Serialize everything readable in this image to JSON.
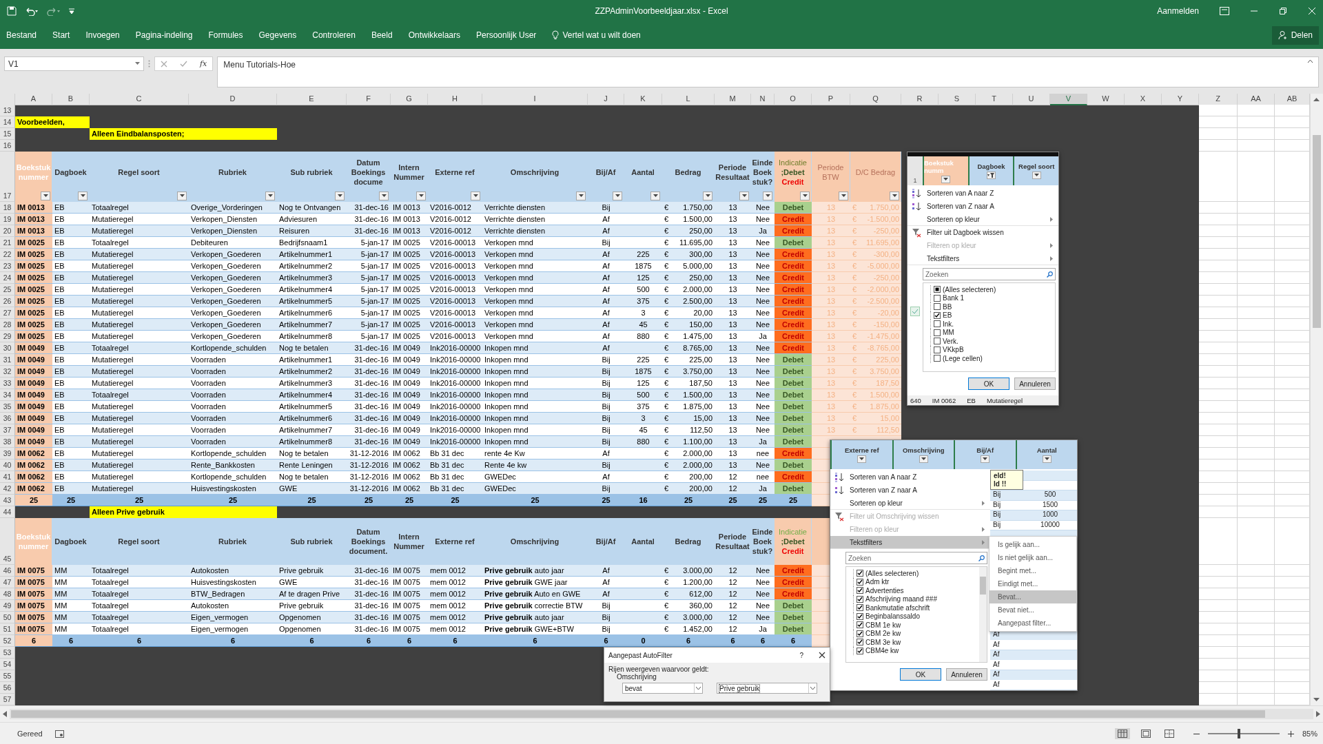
{
  "title_bar": {
    "title": "ZZPAdminVoorbeeldjaar.xlsx - Excel",
    "sign_in": "Aanmelden"
  },
  "ribbon": {
    "tabs": [
      "Bestand",
      "Start",
      "Invoegen",
      "Pagina-indeling",
      "Formules",
      "Gegevens",
      "Controleren",
      "Beeld",
      "Ontwikkelaars",
      "Persoonlijk User"
    ],
    "tell_me": "Vertel wat u wilt doen",
    "share": "Delen"
  },
  "formula_bar": {
    "name_box": "V1",
    "function_label": "fx",
    "formula": "Menu Tutorials-Hoe"
  },
  "columns": [
    {
      "label": "A",
      "selected": false
    },
    {
      "label": "B",
      "selected": false
    },
    {
      "label": "C",
      "selected": false
    },
    {
      "label": "D",
      "selected": false
    },
    {
      "label": "E",
      "selected": false
    },
    {
      "label": "F",
      "selected": false
    },
    {
      "label": "G",
      "selected": false
    },
    {
      "label": "H",
      "selected": false
    },
    {
      "label": "I",
      "selected": false
    },
    {
      "label": "J",
      "selected": false
    },
    {
      "label": "K",
      "selected": false
    },
    {
      "label": "L",
      "selected": false
    },
    {
      "label": "M",
      "selected": false
    },
    {
      "label": "N",
      "selected": false
    },
    {
      "label": "O",
      "selected": false
    },
    {
      "label": "P",
      "selected": false
    },
    {
      "label": "Q",
      "selected": false
    },
    {
      "label": "R",
      "selected": false
    },
    {
      "label": "S",
      "selected": false
    },
    {
      "label": "T",
      "selected": false
    },
    {
      "label": "U",
      "selected": false
    },
    {
      "label": "V",
      "selected": true
    },
    {
      "label": "W",
      "selected": false
    },
    {
      "label": "X",
      "selected": false
    },
    {
      "label": "Y",
      "selected": false
    },
    {
      "label": "Z",
      "selected": false
    },
    {
      "label": "AA",
      "selected": false
    },
    {
      "label": "AB",
      "selected": false
    }
  ],
  "rows": [
    {
      "n": "13",
      "kind": "blank"
    },
    {
      "n": "14",
      "kind": "label",
      "column_a": "Voorbeelden,"
    },
    {
      "n": "15",
      "kind": "label",
      "column_c": "Alleen Eindbalansposten;"
    },
    {
      "n": "16",
      "kind": "blank"
    },
    {
      "n": "17",
      "kind": "header",
      "filters": true,
      "cells": [
        "Boekstuk nummer",
        "Dagboek",
        "Regel soort",
        "Rubriek",
        "Sub rubriek",
        "Datum Boekings docume",
        "Intern Nummer",
        "Externe ref",
        "Omschrijving",
        "Bij/Af",
        "Aantal",
        "Bedrag",
        "Periode Resultaat",
        "Einde Boek stuk?",
        [
          "Indicatie",
          ";Debet",
          "Credit"
        ],
        "Periode BTW",
        "D/C Bedrag"
      ]
    },
    {
      "n": "18",
      "kind": "data",
      "credit": false,
      "cells": [
        "IM 0013",
        "EB",
        "Totaalregel",
        "Overige_Vorderingen",
        "Nog te Ontvangen",
        "31-dec-16",
        "IM 0013",
        "V2016-0012",
        "Verrichte diensten",
        "Bij",
        null,
        "€",
        "1.750,00",
        "13",
        "Nee",
        "Debet",
        "13",
        "€",
        "1.750,00"
      ]
    },
    {
      "n": "19",
      "kind": "data",
      "credit": true,
      "cells": [
        "IM 0013",
        "EB",
        "Mutatieregel",
        "Verkopen_Diensten",
        "Adviesuren",
        "31-dec-16",
        "IM 0013",
        "V2016-0012",
        "Verrichte diensten",
        "Af",
        null,
        "€",
        "1.500,00",
        "13",
        "Nee",
        "Credit",
        "13",
        "€",
        "-1.500,00"
      ]
    },
    {
      "n": "20",
      "kind": "data",
      "credit": true,
      "cells": [
        "IM 0013",
        "EB",
        "Mutatieregel",
        "Verkopen_Diensten",
        "Reisuren",
        "31-dec-16",
        "IM 0013",
        "V2016-0012",
        "Verrichte diensten",
        "Af",
        null,
        "€",
        "250,00",
        "13",
        "Ja",
        "Credit",
        "13",
        "€",
        "-250,00"
      ]
    },
    {
      "n": "21",
      "kind": "data",
      "credit": false,
      "cells": [
        "IM 0025",
        "EB",
        "Totaalregel",
        "Debiteuren",
        "Bedrijfsnaam1",
        "5-jan-17",
        "IM 0025",
        "V2016-00013",
        "Verkopen mnd",
        "Bij",
        null,
        "€",
        "11.695,00",
        "13",
        "Nee",
        "Debet",
        "13",
        "€",
        "11.695,00"
      ]
    },
    {
      "n": "22",
      "kind": "data",
      "credit": true,
      "cells": [
        "IM 0025",
        "EB",
        "Mutatieregel",
        "Verkopen_Goederen",
        "Artikelnummer1",
        "5-jan-17",
        "IM 0025",
        "V2016-00013",
        "Verkopen mnd",
        "Af",
        "225",
        "€",
        "300,00",
        "13",
        "Nee",
        "Credit",
        "13",
        "€",
        "-300,00"
      ]
    },
    {
      "n": "23",
      "kind": "data",
      "credit": true,
      "cells": [
        "IM 0025",
        "EB",
        "Mutatieregel",
        "Verkopen_Goederen",
        "Artikelnummer2",
        "5-jan-17",
        "IM 0025",
        "V2016-00013",
        "Verkopen mnd",
        "Af",
        "1875",
        "€",
        "5.000,00",
        "13",
        "Nee",
        "Credit",
        "13",
        "€",
        "-5.000,00"
      ]
    },
    {
      "n": "24",
      "kind": "data",
      "credit": true,
      "cells": [
        "IM 0025",
        "EB",
        "Mutatieregel",
        "Verkopen_Goederen",
        "Artikelnummer3",
        "5-jan-17",
        "IM 0025",
        "V2016-00013",
        "Verkopen mnd",
        "Af",
        "125",
        "€",
        "250,00",
        "13",
        "Nee",
        "Credit",
        "13",
        "€",
        "-250,00"
      ]
    },
    {
      "n": "25",
      "kind": "data",
      "credit": true,
      "cells": [
        "IM 0025",
        "EB",
        "Mutatieregel",
        "Verkopen_Goederen",
        "Artikelnummer4",
        "5-jan-17",
        "IM 0025",
        "V2016-00013",
        "Verkopen mnd",
        "Af",
        "500",
        "€",
        "2.000,00",
        "13",
        "Nee",
        "Credit",
        "13",
        "€",
        "-2.000,00"
      ]
    },
    {
      "n": "26",
      "kind": "data",
      "credit": true,
      "cells": [
        "IM 0025",
        "EB",
        "Mutatieregel",
        "Verkopen_Goederen",
        "Artikelnummer5",
        "5-jan-17",
        "IM 0025",
        "V2016-00013",
        "Verkopen mnd",
        "Af",
        "375",
        "€",
        "2.500,00",
        "13",
        "Nee",
        "Credit",
        "13",
        "€",
        "-2.500,00"
      ]
    },
    {
      "n": "27",
      "kind": "data",
      "credit": true,
      "cells": [
        "IM 0025",
        "EB",
        "Mutatieregel",
        "Verkopen_Goederen",
        "Artikelnummer6",
        "5-jan-17",
        "IM 0025",
        "V2016-00013",
        "Verkopen mnd",
        "Af",
        "3",
        "€",
        "20,00",
        "13",
        "Nee",
        "Credit",
        "13",
        "€",
        "-20,00"
      ]
    },
    {
      "n": "28",
      "kind": "data",
      "credit": true,
      "cells": [
        "IM 0025",
        "EB",
        "Mutatieregel",
        "Verkopen_Goederen",
        "Artikelnummer7",
        "5-jan-17",
        "IM 0025",
        "V2016-00013",
        "Verkopen mnd",
        "Af",
        "45",
        "€",
        "150,00",
        "13",
        "Nee",
        "Credit",
        "13",
        "€",
        "-150,00"
      ]
    },
    {
      "n": "29",
      "kind": "data",
      "credit": true,
      "cells": [
        "IM 0025",
        "EB",
        "Mutatieregel",
        "Verkopen_Goederen",
        "Artikelnummer8",
        "5-jan-17",
        "IM 0025",
        "V2016-00013",
        "Verkopen mnd",
        "Af",
        "880",
        "€",
        "1.475,00",
        "13",
        "Ja",
        "Credit",
        "13",
        "€",
        "-1.475,00"
      ]
    },
    {
      "n": "30",
      "kind": "data",
      "credit": true,
      "cells": [
        "IM 0049",
        "EB",
        "Totaalregel",
        "Kortlopende_schulden",
        "Nog te betalen",
        "31-dec-16",
        "IM 0049",
        "Ink2016-00000",
        "Inkopen mnd",
        "Af",
        null,
        "€",
        "8.765,00",
        "13",
        "Nee",
        "Credit",
        "13",
        "€",
        "-8.765,00"
      ]
    },
    {
      "n": "31",
      "kind": "data",
      "credit": false,
      "cells": [
        "IM 0049",
        "EB",
        "Mutatieregel",
        "Voorraden",
        "Artikelnummer1",
        "31-dec-16",
        "IM 0049",
        "Ink2016-00000",
        "Inkopen mnd",
        "Bij",
        "225",
        "€",
        "225,00",
        "13",
        "Nee",
        "Debet",
        "13",
        "€",
        "225,00"
      ]
    },
    {
      "n": "32",
      "kind": "data",
      "credit": false,
      "cells": [
        "IM 0049",
        "EB",
        "Mutatieregel",
        "Voorraden",
        "Artikelnummer2",
        "31-dec-16",
        "IM 0049",
        "Ink2016-00000",
        "Inkopen mnd",
        "Bij",
        "1875",
        "€",
        "3.750,00",
        "13",
        "Nee",
        "Debet",
        "13",
        "€",
        "3.750,00"
      ]
    },
    {
      "n": "33",
      "kind": "data",
      "credit": false,
      "cells": [
        "IM 0049",
        "EB",
        "Mutatieregel",
        "Voorraden",
        "Artikelnummer3",
        "31-dec-16",
        "IM 0049",
        "Ink2016-00000",
        "Inkopen mnd",
        "Bij",
        "125",
        "€",
        "187,50",
        "13",
        "Nee",
        "Debet",
        "13",
        "€",
        "187,50"
      ]
    },
    {
      "n": "34",
      "kind": "data",
      "credit": false,
      "cells": [
        "IM 0049",
        "EB",
        "Totaalregel",
        "Voorraden",
        "Artikelnummer4",
        "31-dec-16",
        "IM 0049",
        "Ink2016-00000",
        "Inkopen mnd",
        "Bij",
        "500",
        "€",
        "1.500,00",
        "13",
        "Nee",
        "Debet",
        "13",
        "€",
        "1.500,00"
      ]
    },
    {
      "n": "35",
      "kind": "data",
      "credit": false,
      "cells": [
        "IM 0049",
        "EB",
        "Mutatieregel",
        "Voorraden",
        "Artikelnummer5",
        "31-dec-16",
        "IM 0049",
        "Ink2016-00000",
        "Inkopen mnd",
        "Bij",
        "375",
        "€",
        "1.875,00",
        "13",
        "Nee",
        "Debet",
        "13",
        "€",
        "1.875,00"
      ]
    },
    {
      "n": "36",
      "kind": "data",
      "credit": false,
      "cells": [
        "IM 0049",
        "EB",
        "Mutatieregel",
        "Voorraden",
        "Artikelnummer6",
        "31-dec-16",
        "IM 0049",
        "Ink2016-00000",
        "Inkopen mnd",
        "Bij",
        "3",
        "€",
        "15,00",
        "13",
        "Nee",
        "Debet",
        "13",
        "€",
        "15,00"
      ]
    },
    {
      "n": "37",
      "kind": "data",
      "credit": false,
      "cells": [
        "IM 0049",
        "EB",
        "Mutatieregel",
        "Voorraden",
        "Artikelnummer7",
        "31-dec-16",
        "IM 0049",
        "Ink2016-00000",
        "Inkopen mnd",
        "Bij",
        "45",
        "€",
        "112,50",
        "13",
        "Nee",
        "Debet",
        "13",
        "€",
        "112,50"
      ]
    },
    {
      "n": "38",
      "kind": "data",
      "credit": false,
      "cells": [
        "IM 0049",
        "EB",
        "Mutatieregel",
        "Voorraden",
        "Artikelnummer8",
        "31-dec-16",
        "IM 0049",
        "Ink2016-00000",
        "Inkopen mnd",
        "Bij",
        "880",
        "€",
        "1.100,00",
        "13",
        "Ja",
        "Debet",
        null,
        null,
        null
      ]
    },
    {
      "n": "39",
      "kind": "data",
      "credit": true,
      "cells": [
        "IM 0062",
        "EB",
        "Mutatieregel",
        "Kortlopende_schulden",
        "Nog te betalen",
        "31-12-2016",
        "IM 0062",
        "Bb 31 dec",
        "rente 4e Kw",
        "Af",
        null,
        "€",
        "2.000,00",
        "13",
        "nee",
        "Credit",
        null,
        null,
        null
      ]
    },
    {
      "n": "40",
      "kind": "data",
      "credit": false,
      "cells": [
        "IM 0062",
        "EB",
        "Mutatieregel",
        "Rente_Bankkosten",
        "Rente Leningen",
        "31-12-2016",
        "IM 0062",
        "Bb 31 dec",
        "Rente 4e kw",
        "Bij",
        null,
        "€",
        "2.000,00",
        "13",
        "Nee",
        "Debet",
        null,
        null,
        null
      ]
    },
    {
      "n": "41",
      "kind": "data",
      "credit": true,
      "cells": [
        "IM 0062",
        "EB",
        "Mutatieregel",
        "Kortlopende_schulden",
        "Nog te betalen",
        "31-12-2016",
        "IM 0062",
        "Bb 31 dec",
        "GWEDec",
        "Af",
        null,
        "€",
        "200,00",
        "12",
        "nee",
        "Credit",
        null,
        null,
        null
      ]
    },
    {
      "n": "42",
      "kind": "data",
      "credit": false,
      "cells": [
        "IM 0062",
        "EB",
        "Mutatieregel",
        "Huisvestingskosten",
        "GWE",
        "31-12-2016",
        "IM 0062",
        "Bb 31 dec",
        "GWEDec",
        "Bij",
        null,
        "€",
        "200,00",
        "12",
        "Ja",
        "Debet",
        null,
        null,
        null
      ]
    },
    {
      "n": "43",
      "kind": "total",
      "cells": [
        "25",
        "25",
        "25",
        "25",
        "25",
        "25",
        "25",
        "25",
        "25",
        "25",
        "16",
        "25",
        "25",
        "25",
        "25"
      ]
    },
    {
      "n": "44",
      "kind": "label",
      "column_c": "Alleen Prive gebruik"
    },
    {
      "n": "45",
      "kind": "header",
      "filters": false,
      "cells": [
        "Boekstuk nummer",
        "Dagboek",
        "Regel soort",
        "Rubriek",
        "Sub rubriek",
        "Datum Boekings document.",
        "Intern Nummer",
        "Externe ref",
        "Omschrijving",
        "Bij/Af",
        "Aantal",
        "Bedrag",
        "Periode Resultaat",
        "Einde Boek stuk?",
        [
          "Indicatie",
          ";Debet",
          "Credit"
        ],
        null,
        null
      ]
    },
    {
      "n": "46",
      "kind": "data",
      "credit": true,
      "cells": [
        "IM 0075",
        "MM",
        "Totaalregel",
        "Autokosten",
        "Prive gebruik",
        "31-dec-16",
        "IM 0075",
        "mem 0012",
        "**Prive gebruik** auto jaar",
        "Af",
        null,
        "€",
        "3.000,00",
        "12",
        "Nee",
        "Credit",
        null,
        null,
        null
      ]
    },
    {
      "n": "47",
      "kind": "data",
      "credit": true,
      "cells": [
        "IM 0075",
        "MM",
        "Totaalregel",
        "Huisvestingskosten",
        "GWE",
        "31-dec-16",
        "IM 0075",
        "mem 0012",
        "**Prive gebruik** GWE jaar",
        "Af",
        null,
        "€",
        "1.200,00",
        "12",
        "Nee",
        "Credit",
        null,
        null,
        null
      ]
    },
    {
      "n": "48",
      "kind": "data",
      "credit": true,
      "cells": [
        "IM 0075",
        "MM",
        "Totaalregel",
        "BTW_Bedragen",
        "Af te dragen Prive",
        "31-dec-16",
        "IM 0075",
        "mem 0012",
        "**Prive gebruik** Auto en GWE",
        "Af",
        null,
        "€",
        "612,00",
        "12",
        "Nee",
        "Credit",
        null,
        null,
        null
      ]
    },
    {
      "n": "49",
      "kind": "data",
      "credit": false,
      "cells": [
        "IM 0075",
        "MM",
        "Totaalregel",
        "Autokosten",
        "Prive gebruik",
        "31-dec-16",
        "IM 0075",
        "mem 0012",
        "**Prive gebruik** correctie BTW",
        "Bij",
        null,
        "€",
        "360,00",
        "12",
        "Nee",
        "Debet",
        null,
        null,
        null
      ]
    },
    {
      "n": "50",
      "kind": "data",
      "credit": false,
      "cells": [
        "IM 0075",
        "MM",
        "Totaalregel",
        "Eigen_vermogen",
        "Opgenomen",
        "31-dec-16",
        "IM 0075",
        "mem 0012",
        "**Prive gebruik** auto jaar",
        "Bij",
        null,
        "€",
        "3.000,00",
        "12",
        "Nee",
        "Debet",
        null,
        null,
        null
      ]
    },
    {
      "n": "51",
      "kind": "data",
      "credit": false,
      "cells": [
        "IM 0075",
        "MM",
        "Totaalregel",
        "Eigen_vermogen",
        "Opgenomen",
        "31-dec-16",
        "IM 0075",
        "mem 0012",
        "**Prive gebruik** GWE+BTW",
        "Bij",
        null,
        "€",
        "1.452,00",
        "12",
        "Ja",
        "Debet",
        null,
        null,
        null
      ]
    },
    {
      "n": "52",
      "kind": "total",
      "cells": [
        "6",
        "6",
        "6",
        "6",
        "6",
        "6",
        "6",
        "6",
        "6",
        "6",
        "0",
        "6",
        "6",
        "6",
        "6"
      ]
    },
    {
      "n": "53",
      "kind": "blank"
    },
    {
      "n": "54",
      "kind": "blank"
    },
    {
      "n": "55",
      "kind": "blank"
    },
    {
      "n": "56",
      "kind": "blank"
    },
    {
      "n": "57",
      "kind": "blank"
    }
  ],
  "filter_popups": [
    {
      "row_number": "1",
      "headers": [
        {
          "label": "Boekstuk numm",
          "filtered": false
        },
        {
          "label": "Dagboek",
          "filtered": true
        },
        {
          "label": "Regel soort",
          "filtered": false
        }
      ],
      "menu": [
        {
          "label": "Sorteren van A naar Z",
          "kind": "sort-az",
          "disabled": false,
          "submenu": false,
          "selected": false
        },
        {
          "label": "Sorteren van Z naar A",
          "kind": "sort-za",
          "disabled": false,
          "submenu": false,
          "selected": false
        },
        {
          "label": "Sorteren op kleur",
          "kind": "plain",
          "disabled": false,
          "submenu": true,
          "selected": false
        },
        {
          "label": "Filter uit Dagboek wissen",
          "kind": "clear",
          "disabled": false,
          "submenu": false,
          "selected": false
        },
        {
          "label": "Filteren op kleur",
          "kind": "plain",
          "disabled": true,
          "submenu": true,
          "selected": false
        },
        {
          "label": "Tekstfilters",
          "kind": "plain",
          "disabled": false,
          "submenu": true,
          "selected": false
        }
      ],
      "search": {
        "placeholder": "Zoeken"
      },
      "options": [
        {
          "label": "(Alles selecteren)",
          "checked": false,
          "partial": true
        },
        {
          "label": "Bank 1",
          "checked": false,
          "partial": false
        },
        {
          "label": "BB",
          "checked": false,
          "partial": false
        },
        {
          "label": "EB",
          "checked": true,
          "partial": false
        },
        {
          "label": "Ink.",
          "checked": false,
          "partial": false
        },
        {
          "label": "MM",
          "checked": false,
          "partial": false
        },
        {
          "label": "Verk.",
          "checked": false,
          "partial": false
        },
        {
          "label": "VKkpB",
          "checked": false,
          "partial": false
        },
        {
          "label": "(Lege cellen)",
          "checked": false,
          "partial": false
        }
      ],
      "buttons": [
        "OK",
        "Annuleren"
      ],
      "footer_row": [
        "640",
        "IM 0062",
        "EB",
        "Mutatieregel"
      ]
    },
    {
      "headers": [
        {
          "label": "Externe ref",
          "filtered": false
        },
        {
          "label": "Omschrijving",
          "filtered": false
        },
        {
          "label": "Bij/Af",
          "filtered": false
        },
        {
          "label": "Aantal",
          "filtered": false
        }
      ],
      "menu": [
        {
          "label": "Sorteren van A naar Z",
          "kind": "sort-az",
          "disabled": false,
          "submenu": false,
          "selected": false
        },
        {
          "label": "Sorteren van Z naar A",
          "kind": "sort-za",
          "disabled": false,
          "submenu": false,
          "selected": false
        },
        {
          "label": "Sorteren op kleur",
          "kind": "plain",
          "disabled": false,
          "submenu": true,
          "selected": false
        },
        {
          "label": "Filter uit Omschrijving wissen",
          "kind": "clear",
          "disabled": true,
          "submenu": false,
          "selected": false
        },
        {
          "label": "Filteren op kleur",
          "kind": "plain",
          "disabled": true,
          "submenu": true,
          "selected": false
        },
        {
          "label": "Tekstfilters",
          "kind": "plain",
          "disabled": false,
          "submenu": true,
          "selected": true
        }
      ],
      "search": {
        "placeholder": "Zoeken"
      },
      "options": [
        {
          "label": "(Alles selecteren)",
          "checked": true,
          "partial": false
        },
        {
          "label": "Adm ktr",
          "checked": true,
          "partial": false
        },
        {
          "label": "Advertenties",
          "checked": true,
          "partial": false
        },
        {
          "label": "Afschrijving maand ###",
          "checked": true,
          "partial": false
        },
        {
          "label": "Bankmutatie afschrift",
          "checked": true,
          "partial": false
        },
        {
          "label": "Beginbalanssaldo",
          "checked": true,
          "partial": false
        },
        {
          "label": "CBM 1e kw",
          "checked": true,
          "partial": false
        },
        {
          "label": "CBM 2e kw",
          "checked": true,
          "partial": false
        },
        {
          "label": "CBM 3e kw",
          "checked": true,
          "partial": false
        },
        {
          "label": "CBM4e kw",
          "checked": true,
          "partial": false
        }
      ],
      "buttons": [
        "OK",
        "Annuleren"
      ],
      "tooltip": [
        "eld!",
        "ld !!"
      ],
      "strip_rows": [
        null,
        null,
        [
          "Bij",
          "500"
        ],
        [
          "Bij",
          "1500"
        ],
        [
          "Bij",
          "1000"
        ],
        [
          "Bij",
          "10000"
        ],
        null,
        null,
        null,
        null,
        null,
        null,
        null,
        null,
        null,
        null,
        [
          "Af",
          null
        ],
        [
          "Af",
          null
        ],
        [
          "Af",
          null
        ],
        [
          "Af",
          null
        ],
        [
          "Af",
          null
        ],
        [
          "Af",
          null
        ]
      ],
      "submenu": [
        {
          "label": "Is gelijk aan...",
          "selected": false
        },
        {
          "label": "Is niet gelijk aan...",
          "selected": false
        },
        {
          "label": "Begint met...",
          "selected": false
        },
        {
          "label": "Eindigt met...",
          "selected": false
        },
        {
          "label": "Bevat...",
          "selected": true
        },
        {
          "label": "Bevat niet...",
          "selected": false
        },
        {
          "label": "Aangepast filter...",
          "selected": false
        }
      ]
    }
  ],
  "dialog": {
    "title": "Aangepast AutoFilter",
    "help": "?",
    "prompt": "Rijen weergeven waarvoor geldt:",
    "field_label": "Omschrijving",
    "operator": "bevat",
    "value": "Prive gebruik"
  },
  "status_bar": {
    "status": "Gereed",
    "views": [
      {
        "kind": "normal",
        "selected": true
      },
      {
        "kind": "layout",
        "selected": false
      },
      {
        "kind": "pagebreak",
        "selected": false
      }
    ],
    "zoom": {
      "level": 0.43,
      "reading": "85%"
    }
  }
}
